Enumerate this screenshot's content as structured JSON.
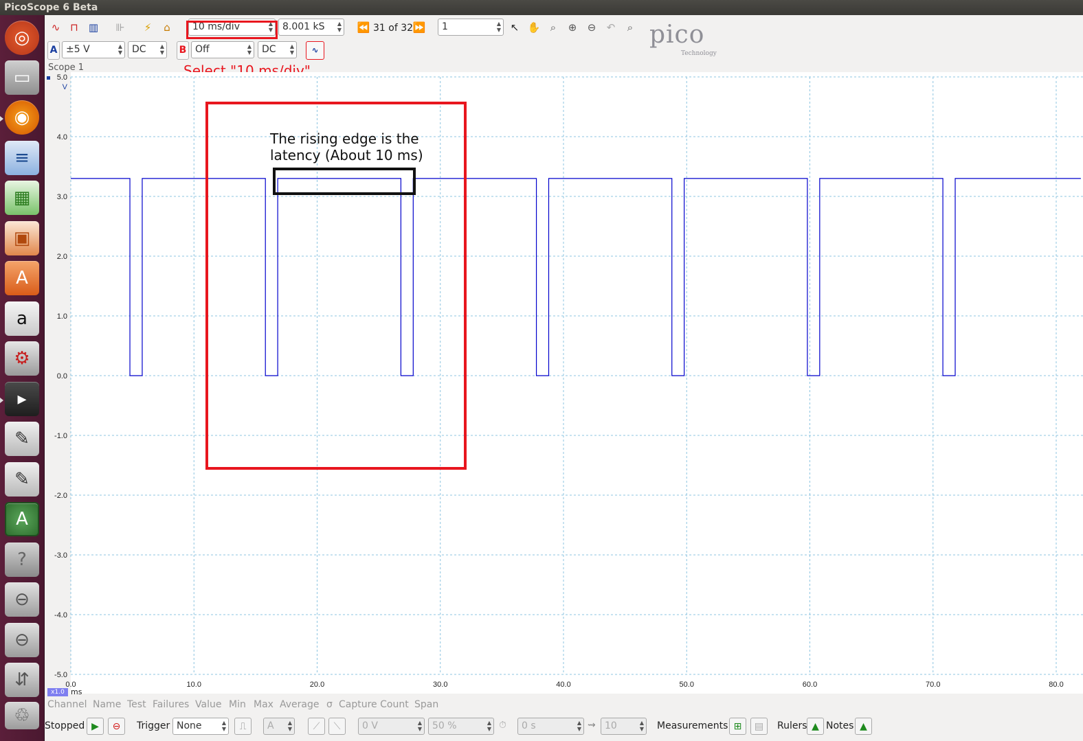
{
  "window": {
    "title": "PicoScope 6 Beta"
  },
  "toolbar": {
    "timebase": "10 ms/div",
    "samples": "8.001 kS",
    "capture_position": "31 of 32",
    "capture_count_input": "1"
  },
  "channel_a": {
    "label": "A",
    "range": "±5 V",
    "coupling": "DC"
  },
  "channel_b": {
    "label": "B",
    "range": "Off",
    "coupling": "DC"
  },
  "scope": {
    "name": "Scope 1",
    "y_unit": "V",
    "x_unit": "ms",
    "x_scale_badge": "x1.0"
  },
  "annotations": {
    "select_note": "Select \"10 ms/div\"",
    "latency_line1": "The rising edge is the",
    "latency_line2": "latency (About 10 ms)"
  },
  "logo": {
    "brand": "pico",
    "sub": "Technology"
  },
  "measurements_header": [
    "Channel",
    "Name",
    "Test",
    "Failures",
    "Value",
    "Min",
    "Max",
    "Average",
    "σ",
    "Capture Count",
    "Span"
  ],
  "statusbar": {
    "state": "Stopped",
    "trigger_label": "Trigger",
    "trigger_mode": "None",
    "trigger_source": "A",
    "trigger_level": "0 V",
    "pretrigger": "50 %",
    "delay": "0 s",
    "rapid_count": "10",
    "measurements_label": "Measurements",
    "rulers_label": "Rulers",
    "notes_label": "Notes"
  },
  "colors": {
    "trace_a": "#0000cc",
    "grid": "#8cc4e0",
    "highlight": "#e8161e",
    "annotation_box": "#111111"
  },
  "chart_data": {
    "type": "line",
    "xlabel": "ms",
    "ylabel": "V",
    "xlim": [
      0,
      82
    ],
    "ylim": [
      -5,
      5
    ],
    "x_ticks": [
      "0.0",
      "10.0",
      "20.0",
      "30.0",
      "40.0",
      "50.0",
      "60.0",
      "70.0",
      "80.0"
    ],
    "y_ticks": [
      "5.0",
      "4.0",
      "3.0",
      "2.0",
      "1.0",
      "0.0",
      "-1.0",
      "-2.0",
      "-3.0",
      "-4.0",
      "-5.0"
    ],
    "grid": true,
    "series": [
      {
        "name": "A",
        "high_level": 3.3,
        "low_level": 0.0,
        "low_pulses_ms": [
          [
            4.8,
            5.8
          ],
          [
            15.8,
            16.8
          ],
          [
            26.8,
            27.8
          ],
          [
            37.8,
            38.8
          ],
          [
            48.8,
            49.8
          ],
          [
            59.8,
            60.8
          ],
          [
            70.8,
            71.8
          ]
        ]
      }
    ]
  }
}
